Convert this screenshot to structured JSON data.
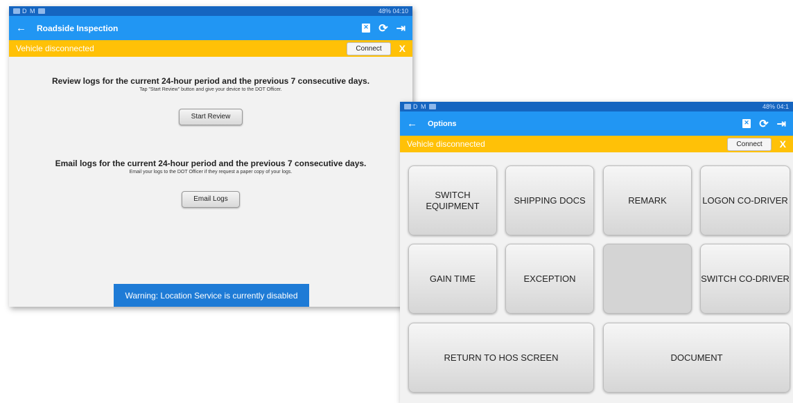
{
  "screen1": {
    "status_bar": {
      "left": "D M",
      "right": "48% 04:10"
    },
    "title": "Roadside Inspection",
    "banner": {
      "message": "Vehicle disconnected",
      "connect_label": "Connect",
      "close_label": "X"
    },
    "review": {
      "heading": "Review logs for the current 24-hour period and the previous 7 consecutive days.",
      "sub": "Tap \"Start Review\" button and give your device to the DOT Officer.",
      "button": "Start Review"
    },
    "email": {
      "heading": "Email logs for the current 24-hour period and the previous 7 consecutive days.",
      "sub": "Email your logs to the DOT Officer if they request a paper copy of your logs.",
      "button": "Email Logs"
    },
    "warning": "Warning: Location Service is currently disabled"
  },
  "screen2": {
    "status_bar": {
      "left": "D M",
      "right": "48% 04:1"
    },
    "title": "Options",
    "banner": {
      "message": "Vehicle disconnected",
      "connect_label": "Connect",
      "close_label": "X"
    },
    "tiles": [
      {
        "label": "SWITCH EQUIPMENT"
      },
      {
        "label": "SHIPPING DOCS"
      },
      {
        "label": "REMARK"
      },
      {
        "label": "LOGON CO-DRIVER"
      },
      {
        "label": "GAIN TIME"
      },
      {
        "label": "EXCEPTION"
      },
      {
        "label": ""
      },
      {
        "label": "SWITCH CO-DRIVER"
      },
      {
        "label": "RETURN TO HOS SCREEN"
      },
      {
        "label": "DOCUMENT"
      }
    ]
  },
  "icons": {
    "back": "arrow-left-icon",
    "pdf": "pdf-icon",
    "refresh": "refresh-icon",
    "logout": "logout-icon"
  },
  "colors": {
    "status_bar": "#1565c0",
    "app_bar": "#2196f3",
    "banner": "#ffc107",
    "warning": "#1e7bd6"
  }
}
